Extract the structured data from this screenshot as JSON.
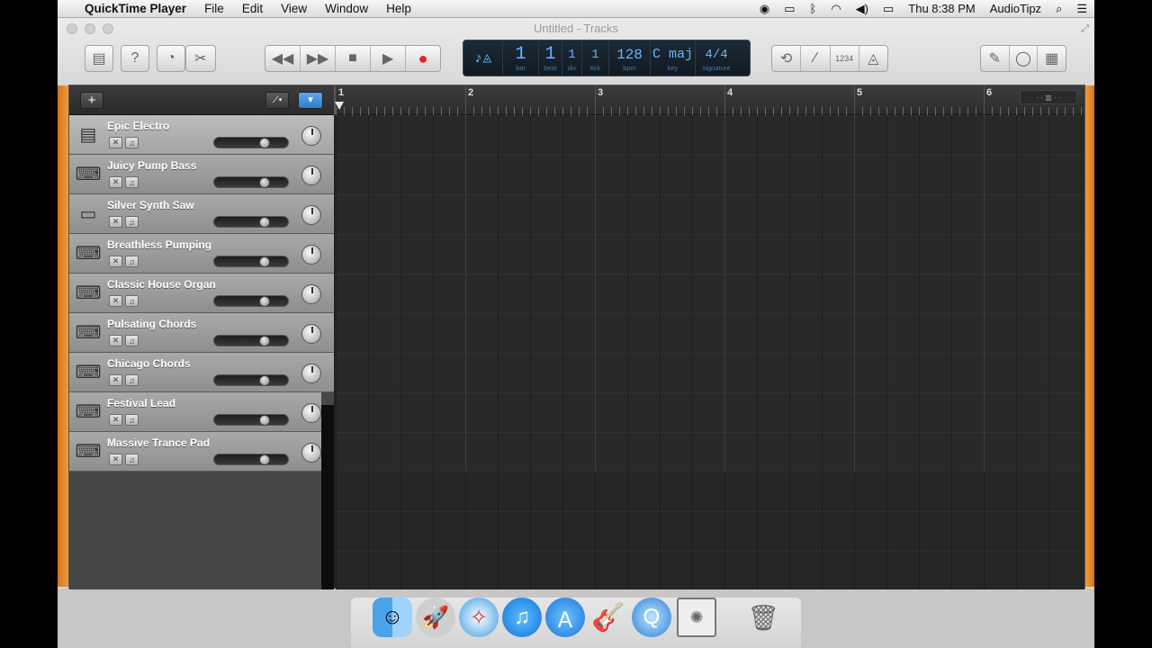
{
  "menubar": {
    "apple": "",
    "app_name": "QuickTime Player",
    "items": [
      "File",
      "Edit",
      "View",
      "Window",
      "Help"
    ],
    "clock": "Thu 8:38 PM",
    "user": "AudioTipz"
  },
  "window": {
    "title": "Untitled - Tracks"
  },
  "lcd": {
    "bar": "1",
    "bar_label": "bar",
    "beat": "1",
    "beat_label": "beat",
    "div": "1",
    "div_label": "div",
    "tick": "1",
    "tick_label": "tick",
    "bpm": "128",
    "bpm_label": "bpm",
    "key": "C maj",
    "key_label": "key",
    "signature": "4/4",
    "signature_label": "signature"
  },
  "count_in": "1234",
  "tracks": [
    {
      "name": "Epic Electro",
      "icon": "drum-machine-icon",
      "volume": 0.72
    },
    {
      "name": "Juicy Pump Bass",
      "icon": "synth-keyboard-icon",
      "volume": 0.72
    },
    {
      "name": "Silver Synth Saw",
      "icon": "synth-module-icon",
      "volume": 0.72
    },
    {
      "name": "Breathless Pumping",
      "icon": "keyboard-stand-icon",
      "volume": 0.72
    },
    {
      "name": "Classic House Organ",
      "icon": "keyboard-stand-icon",
      "volume": 0.72
    },
    {
      "name": "Pulsating Chords",
      "icon": "synth-keyboard-icon",
      "volume": 0.72
    },
    {
      "name": "Chicago Chords",
      "icon": "keyboard-stand-icon",
      "volume": 0.72
    },
    {
      "name": "Festival Lead",
      "icon": "keyboard-stand-icon",
      "volume": 0.72
    },
    {
      "name": "Massive Trance Pad",
      "icon": "keyboard-stand-icon",
      "volume": 0.72
    }
  ],
  "ruler": {
    "bars": [
      "1",
      "2",
      "3",
      "4",
      "5",
      "6"
    ]
  },
  "dock": {
    "apps": [
      "finder-icon",
      "launchpad-icon",
      "safari-icon",
      "itunes-icon",
      "app-store-icon",
      "garageband-icon",
      "quicktime-icon",
      "photo-slideshow-icon",
      "trash-icon"
    ]
  }
}
